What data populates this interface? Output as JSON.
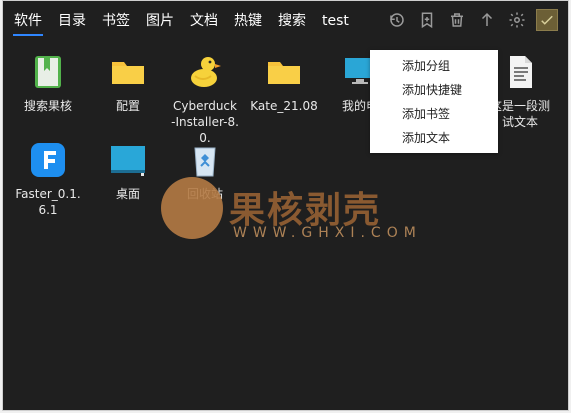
{
  "tabs": [
    "软件",
    "目录",
    "书签",
    "图片",
    "文档",
    "热键",
    "搜索",
    "test"
  ],
  "toolbar": {
    "icons": [
      "history-icon",
      "bookmark-add-icon",
      "trash-icon",
      "upload-arrow-icon",
      "gear-icon",
      "accent-theme-icon"
    ]
  },
  "items": [
    {
      "label": "搜索果核"
    },
    {
      "label": "配置"
    },
    {
      "label": "Cyberduck-Installer-8.0."
    },
    {
      "label": "Kate_21.08"
    },
    {
      "label": "我的电"
    },
    {
      "label": ""
    },
    {
      "label": "这是一段测试文本"
    },
    {
      "label": "Faster_0.1.6.1"
    },
    {
      "label": "桌面"
    },
    {
      "label": "回收站"
    }
  ],
  "context_menu": [
    "添加分组",
    "添加快捷键",
    "添加书签",
    "添加文本"
  ],
  "watermark": {
    "title": "果核剥壳",
    "subtitle": "WWW.GHXI.COM"
  },
  "colors": {
    "background": "#1f1f1f",
    "tab_underline": "#2f86ff",
    "folder": "#f7c23b",
    "accent_tile": "#6c5f36"
  }
}
